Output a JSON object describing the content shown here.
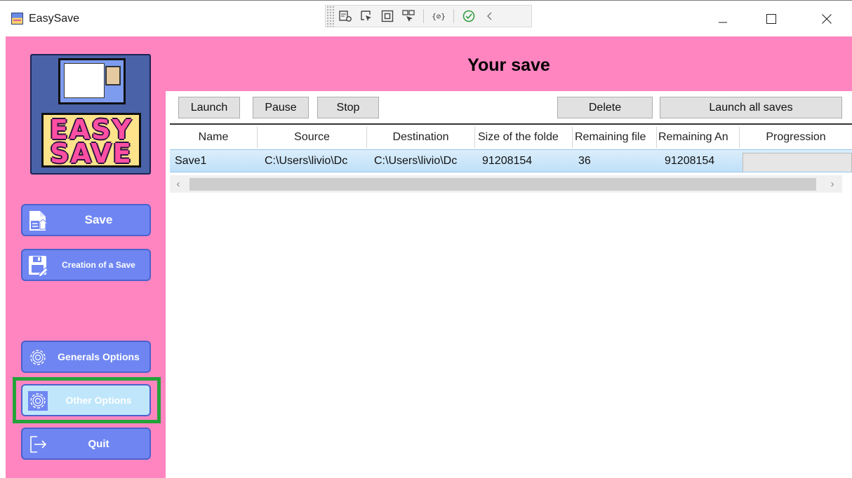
{
  "window": {
    "title": "EasySave",
    "icon": "easysave-app-icon",
    "controls": {
      "minimize": "minimize-icon",
      "maximize": "maximize-icon",
      "close": "close-icon"
    }
  },
  "debug_toolbar": {
    "icons": [
      "live-visual-tree-icon",
      "select-element-icon",
      "display-layout-adorners-icon",
      "track-focused-element-icon",
      "binding-failures-icon",
      "hot-reload-ok-icon",
      "collapse-toolbar-icon"
    ]
  },
  "sidebar": {
    "logo": {
      "line1": "EASY",
      "line2": "SAVE"
    },
    "nav": {
      "save": {
        "label": "Save",
        "icon": "save-file-icon"
      },
      "create": {
        "label": "Creation of a Save",
        "icon": "floppy-edit-icon"
      },
      "general": {
        "label": "Generals Options",
        "icon": "gear-icon"
      },
      "other": {
        "label": "Other Options",
        "icon": "gear-icon",
        "selected": true
      },
      "quit": {
        "label": "Quit",
        "icon": "exit-icon"
      }
    }
  },
  "main": {
    "title": "Your save",
    "actions": {
      "launch": "Launch",
      "pause": "Pause",
      "stop": "Stop",
      "delete": "Delete",
      "launch_all": "Launch all saves"
    },
    "table": {
      "columns": [
        "Name",
        "Source",
        "Destination",
        "Size of the folde",
        "Remaining file",
        "Remaining An",
        "Progression"
      ],
      "rows": [
        {
          "name": "Save1",
          "source": "C:\\Users\\livio\\Dc",
          "destination": "C:\\Users\\livio\\Dc",
          "size": "91208154",
          "remaining_files": "36",
          "remaining_amount": "91208154",
          "progression": 0
        }
      ]
    }
  },
  "colors": {
    "accent_pink": "#ff85c0",
    "button_blue": "#6f86f2",
    "selected_button": "#bfe6fb",
    "focus_outline": "#24a33a"
  }
}
